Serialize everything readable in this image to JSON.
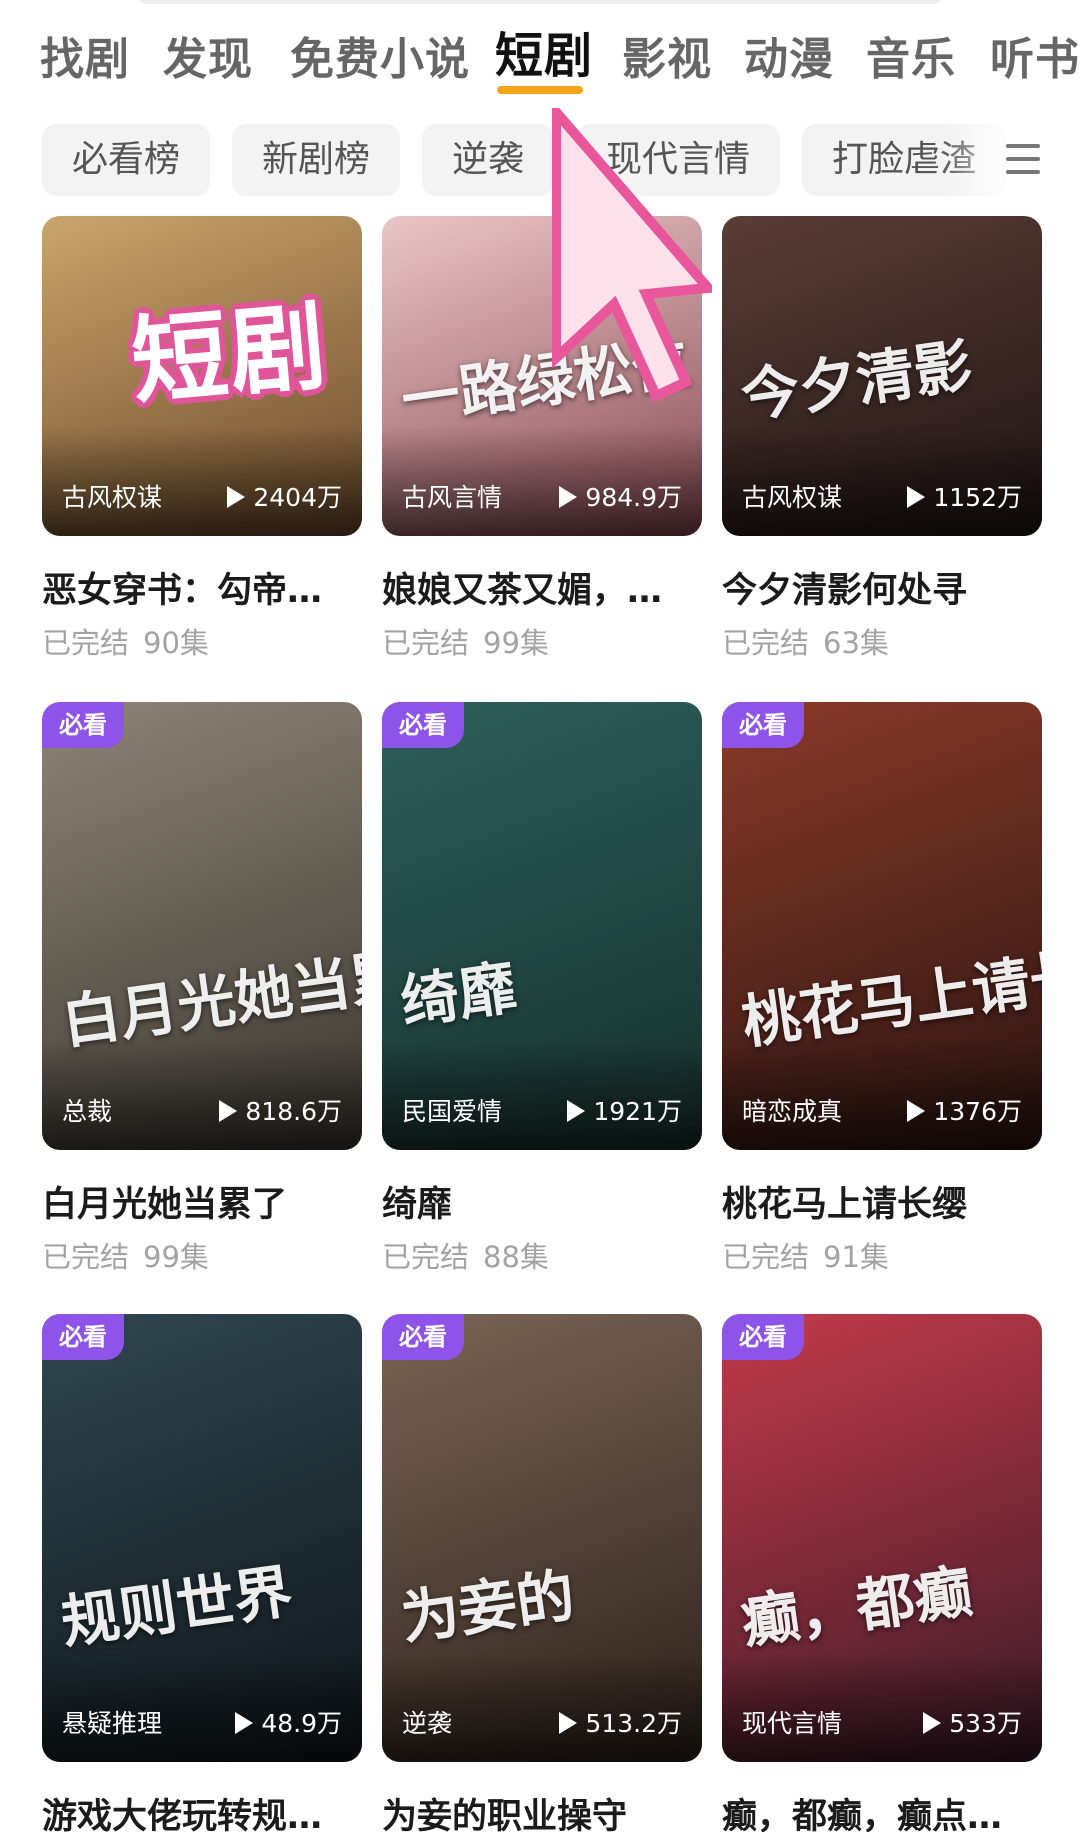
{
  "tabs": [
    "找剧",
    "发现",
    "免费小说",
    "短剧",
    "影视",
    "动漫",
    "音乐",
    "听书"
  ],
  "active_tab": "短剧",
  "chips": [
    "必看榜",
    "新剧榜",
    "逆袭",
    "现代言情",
    "打脸虐渣"
  ],
  "sticker_text": "短剧",
  "cards": [
    {
      "title": "恶女穿书：勾帝…",
      "status": "已完结",
      "episodes": "90集",
      "genre": "古风权谋",
      "plays": "2404万",
      "poster_text": "",
      "badge": "",
      "colors": [
        "#c9a46b",
        "#6b4a2a"
      ]
    },
    {
      "title": "娘娘又茶又媚，…",
      "status": "已完结",
      "episodes": "99集",
      "genre": "古风言情",
      "plays": "984.9万",
      "poster_text": "一路绿松位",
      "badge": "",
      "colors": [
        "#e9c6c8",
        "#8a4a52"
      ]
    },
    {
      "title": "今夕清影何处寻",
      "status": "已完结",
      "episodes": "63集",
      "genre": "古风权谋",
      "plays": "1152万",
      "poster_text": "今夕清影",
      "badge": "",
      "colors": [
        "#5b3d35",
        "#1e1414"
      ]
    },
    {
      "title": "白月光她当累了",
      "status": "已完结",
      "episodes": "99集",
      "genre": "总裁",
      "plays": "818.6万",
      "poster_text": "白月光她当累了",
      "badge": "必看",
      "colors": [
        "#8d8576",
        "#3b3630"
      ]
    },
    {
      "title": "绮靡",
      "status": "已完结",
      "episodes": "88集",
      "genre": "民国爱情",
      "plays": "1921万",
      "poster_text": "绮靡",
      "badge": "必看",
      "colors": [
        "#2d5f5a",
        "#16302d"
      ]
    },
    {
      "title": "桃花马上请长缨",
      "status": "已完结",
      "episodes": "91集",
      "genre": "暗恋成真",
      "plays": "1376万",
      "poster_text": "桃花马上请长缨",
      "badge": "必看",
      "colors": [
        "#8a3a2a",
        "#2a1410"
      ]
    },
    {
      "title": "游戏大佬玩转规…",
      "status": "",
      "episodes": "",
      "genre": "悬疑推理",
      "plays": "48.9万",
      "poster_text": "规则世界",
      "badge": "必看",
      "colors": [
        "#2f4650",
        "#0f161a"
      ]
    },
    {
      "title": "为妾的职业操守",
      "status": "",
      "episodes": "",
      "genre": "逆袭",
      "plays": "513.2万",
      "poster_text": "为妾的",
      "badge": "必看",
      "colors": [
        "#7a6454",
        "#2c211b"
      ]
    },
    {
      "title": "癫，都癫，癫点…",
      "status": "",
      "episodes": "",
      "genre": "现代言情",
      "plays": "533万",
      "poster_text": "癫，都癫",
      "badge": "必看",
      "colors": [
        "#c43a4a",
        "#3a1a28"
      ]
    }
  ]
}
